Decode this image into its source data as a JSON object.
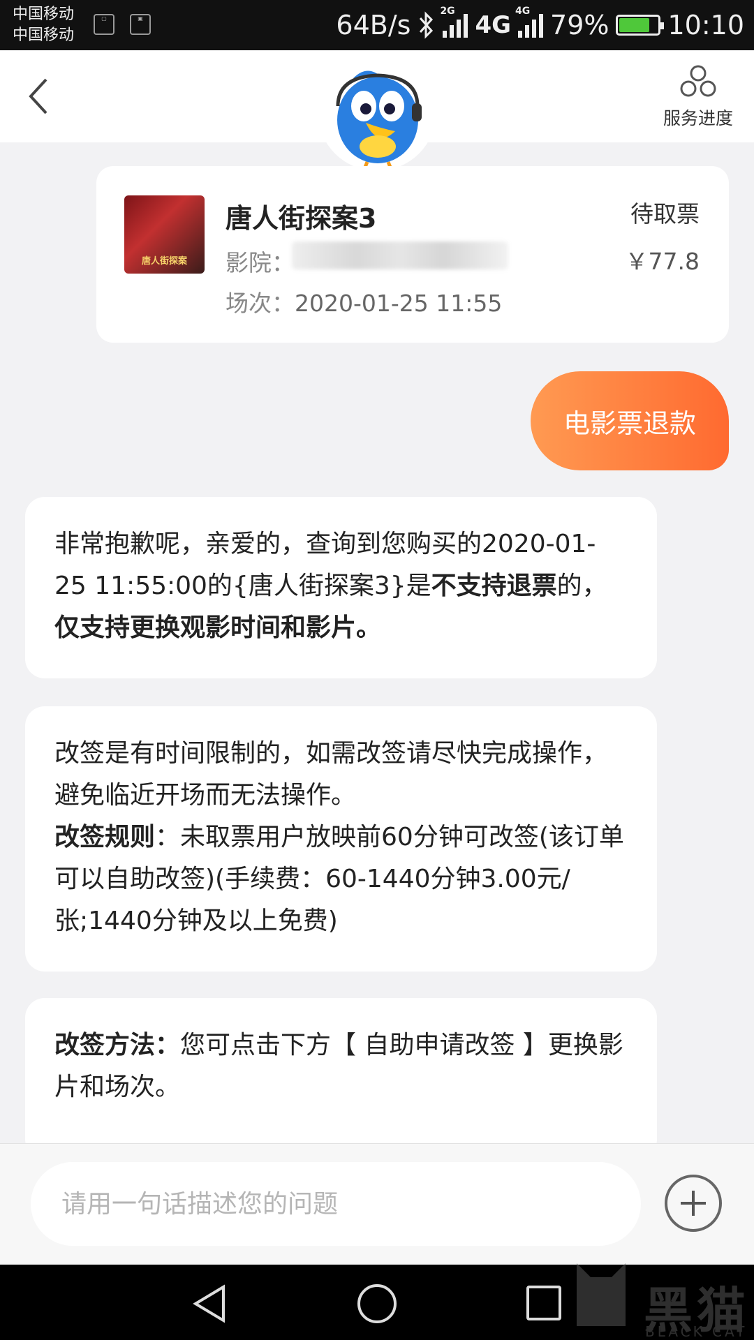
{
  "status_bar": {
    "carrier_1": "中国移动",
    "carrier_2": "中国移动",
    "net_speed": "64B/s",
    "sig1_tag": "2G",
    "net_type": "4G",
    "sig2_tag": "4G",
    "battery_pct": "79%",
    "battery_level": 0.79,
    "time": "10:10"
  },
  "header": {
    "service_progress_label": "服务进度"
  },
  "order": {
    "title": "唐人街探案3",
    "cinema_label": "影院：",
    "showtime_label": "场次：",
    "showtime_value": "2020-01-25 11:55",
    "status": "待取票",
    "price": "￥77.8",
    "poster_text": "唐人街探案"
  },
  "user_message": "电影票退款",
  "bot_messages": {
    "msg1": {
      "t1": "非常抱歉呢，亲爱的，查询到您购买的2020-01-25 11:55:00的{唐人街探案3}是",
      "b1": "不支持退票",
      "t2": "的，",
      "b2": "仅支持更换观影时间和影片。"
    },
    "msg2": {
      "t1": "改签是有时间限制的，如需改签请尽快完成操作，避免临近开场而无法操作。",
      "b1": "改签规则",
      "t2": "：未取票用户放映前60分钟可改签(该订单可以自助改签)(手续费：60-1440分钟3.00元/张;1440分钟及以上免费)"
    },
    "msg3": {
      "b1": "改签方法：",
      "t1": "您可点击下方【 自助申请改签 】更换影片和场次。"
    }
  },
  "input": {
    "placeholder": "请用一句话描述您的问题"
  },
  "watermark": {
    "cn": "黑猫",
    "en": "BLACK CAT"
  }
}
